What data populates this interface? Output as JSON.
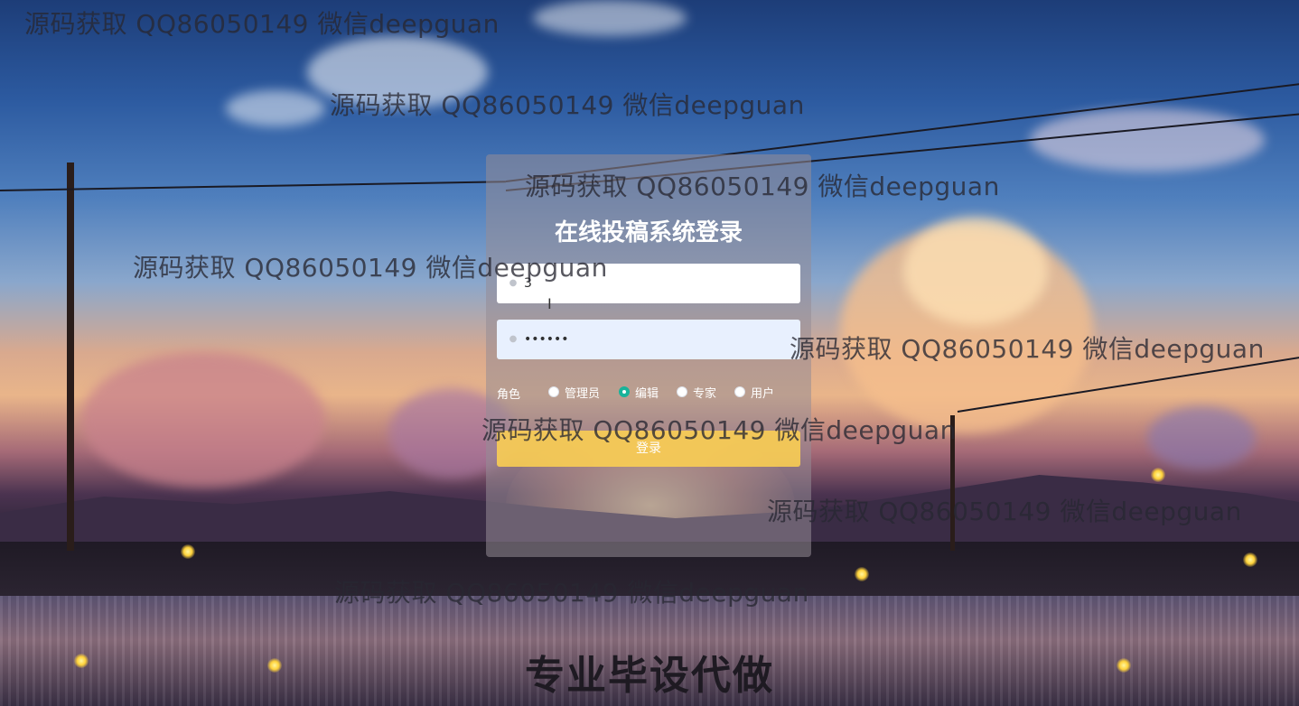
{
  "watermarks": [
    "源码获取 QQ86050149 微信deepguan",
    "源码获取 QQ86050149 微信deepguan",
    "源码获取 QQ86050149 微信deepguan",
    "源码获取 QQ86050149 微信deepguan",
    "源码获取 QQ86050149 微信deepguan",
    "源码获取 QQ86050149 微信deepguan",
    "源码获取 QQ86050149 微信deepguan",
    "源码获取 QQ86050149 微信deepguan"
  ],
  "login": {
    "title": "在线投稿系统登录",
    "username_value": "3",
    "password_value": "••••••",
    "role_label": "角色",
    "roles": [
      {
        "label": "管理员",
        "checked": false
      },
      {
        "label": "编辑",
        "checked": true
      },
      {
        "label": "专家",
        "checked": false
      },
      {
        "label": "用户",
        "checked": false
      }
    ],
    "submit_label": "登录",
    "accent_color": "#19b39a",
    "button_color": "#ffd250"
  },
  "promo_text": "专业毕设代做"
}
